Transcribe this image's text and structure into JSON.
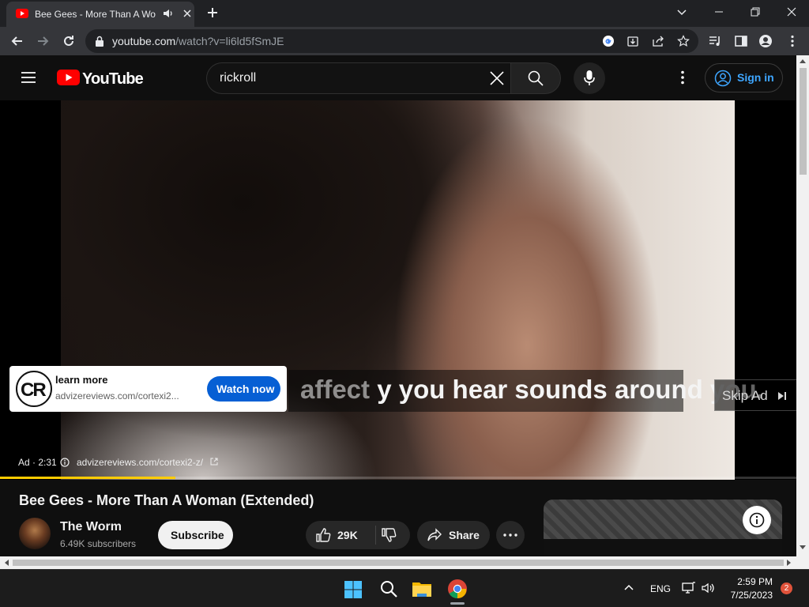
{
  "browser": {
    "tab_title": "Bee Gees - More Than A Wo",
    "url_domain": "youtube.com",
    "url_path": "/watch?v=li6ld5fSmJE"
  },
  "youtube": {
    "logo_text": "YouTube",
    "search_query": "rickroll",
    "signin_label": "Sign in"
  },
  "player": {
    "subtitle": "y you hear sounds around you.",
    "subtitle_partial": "affect",
    "ad_card": {
      "logo_text": "CR",
      "title": "learn more",
      "url": "advizereviews.com/cortexi2...",
      "cta": "Watch now"
    },
    "skip_label": "Skip Ad",
    "ad_badge": "Ad · 2:31",
    "ad_link": "advizereviews.com/cortexi2-z/",
    "progress_fraction": 0.22,
    "progress_color": "#ffcc00"
  },
  "video": {
    "title": "Bee Gees - More Than A Woman (Extended)",
    "channel_name": "The Worm",
    "subscribers": "6.49K subscribers",
    "subscribe_label": "Subscribe",
    "likes": "29K",
    "share_label": "Share"
  },
  "taskbar": {
    "language": "ENG",
    "time": "2:59 PM",
    "date": "7/25/2023",
    "notifications": "2"
  }
}
